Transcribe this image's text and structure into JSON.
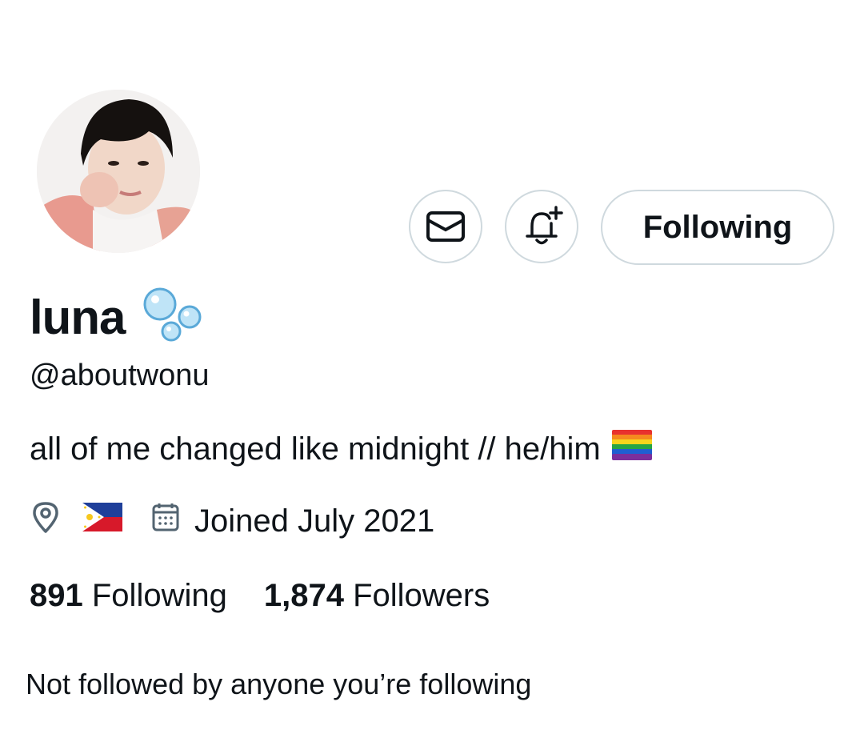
{
  "profile": {
    "display_name": "luna",
    "handle": "@aboutwonu",
    "bio": "all of me changed like midnight // he/him",
    "joined": "Joined July 2021",
    "following_count": "891",
    "following_label": "Following",
    "followers_count": "1,874",
    "followers_label": "Followers",
    "followed_by": "Not followed by anyone you’re following"
  },
  "actions": {
    "follow_button_label": "Following"
  },
  "icons": {
    "message": "envelope-icon",
    "notify": "bell-plus-icon",
    "location": "location-pin-icon",
    "calendar": "calendar-icon",
    "name_emoji": "bubbles-emoji",
    "bio_emoji": "rainbow-flag-emoji",
    "location_value": "philippines-flag-emoji"
  },
  "colors": {
    "text": "#0f1419",
    "border": "#cfd9de",
    "icon_gray": "#536471"
  }
}
